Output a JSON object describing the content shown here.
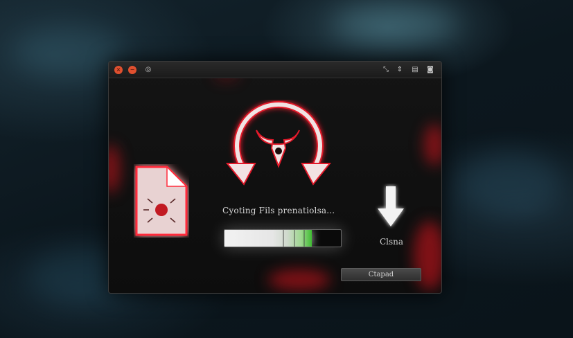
{
  "window": {
    "title_controls": [
      "close",
      "minimize",
      "info"
    ],
    "right_controls": [
      "resize-icon",
      "expand-icon",
      "window-icon",
      "circle-icon"
    ]
  },
  "status": {
    "text": "Cyoting Fils prenatiolsa..."
  },
  "progress": {
    "fraction": 0.75
  },
  "side": {
    "label": "Clsna"
  },
  "button": {
    "label": "Ctapad"
  },
  "icons": {
    "emblem": "bull-emblem-icon",
    "file": "corrupted-file-icon",
    "download": "arrow-down-icon"
  },
  "colors": {
    "accent": "#e2142a",
    "progress_green": "#3fbb32",
    "background": "#0c171e"
  }
}
